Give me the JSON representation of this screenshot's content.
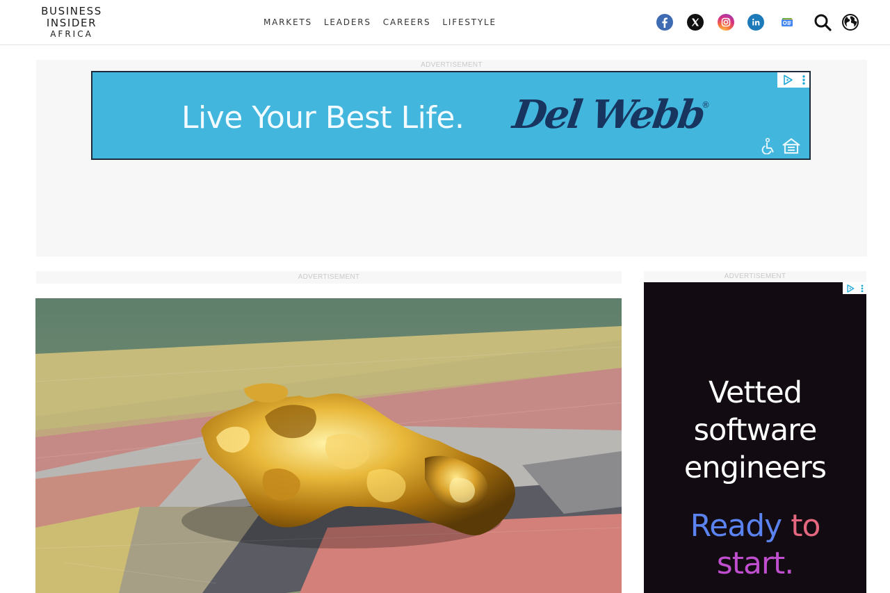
{
  "header": {
    "logo": {
      "line1": "BUSINESS",
      "line2": "INSIDER",
      "line3": "AFRICA"
    },
    "nav": [
      "MARKETS",
      "LEADERS",
      "CAREERS",
      "LIFESTYLE"
    ],
    "social_icons": [
      "facebook-icon",
      "x-icon",
      "instagram-icon",
      "linkedin-icon",
      "google-news-icon"
    ],
    "tools": [
      "search-icon",
      "globe-icon"
    ]
  },
  "ads": {
    "top": {
      "label": "ADVERTISEMENT",
      "tagline": "Live Your Best Life.",
      "brand": "Del Webb",
      "reg": "®",
      "background": "#42b6dd"
    },
    "mid": {
      "label": "ADVERTISEMENT"
    },
    "side": {
      "label": "ADVERTISEMENT",
      "headline": [
        "Vetted",
        "software",
        "engineers"
      ],
      "cta_words": [
        "Ready",
        "to",
        "start."
      ],
      "background": "#120c12"
    }
  },
  "hero": {
    "image": "gold-nugget-photo"
  }
}
